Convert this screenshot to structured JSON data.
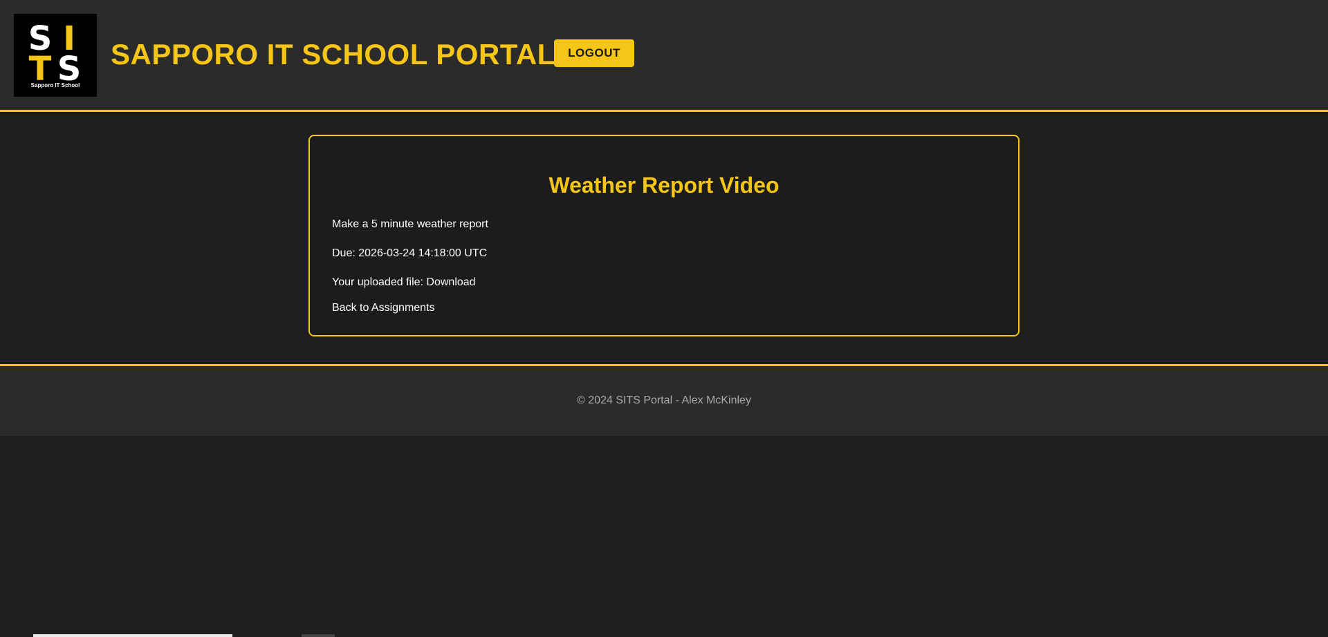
{
  "header": {
    "logo_letters": {
      "s": "S",
      "i": "I",
      "t": "T",
      "s2": "S"
    },
    "logo_caption": "Sapporo IT School",
    "title": "SAPPORO IT SCHOOL PORTAL",
    "logout_label": "LOGOUT"
  },
  "assignment": {
    "title": "Weather Report Video",
    "description": "Make a 5 minute weather report",
    "due_label": "Due:",
    "due_value": "2026-03-24 14:18:00 UTC",
    "file_label": "Your uploaded file:",
    "download_label": "Download",
    "back_label": "Back to Assignments"
  },
  "footer": {
    "text": "© 2024 SITS Portal - Alex McKinley"
  },
  "colors": {
    "accent": "#f5c518",
    "background": "#1e1e1e",
    "header_bg": "#2b2b2b",
    "text": "#ffffff",
    "muted_text": "#aaaaaa"
  }
}
